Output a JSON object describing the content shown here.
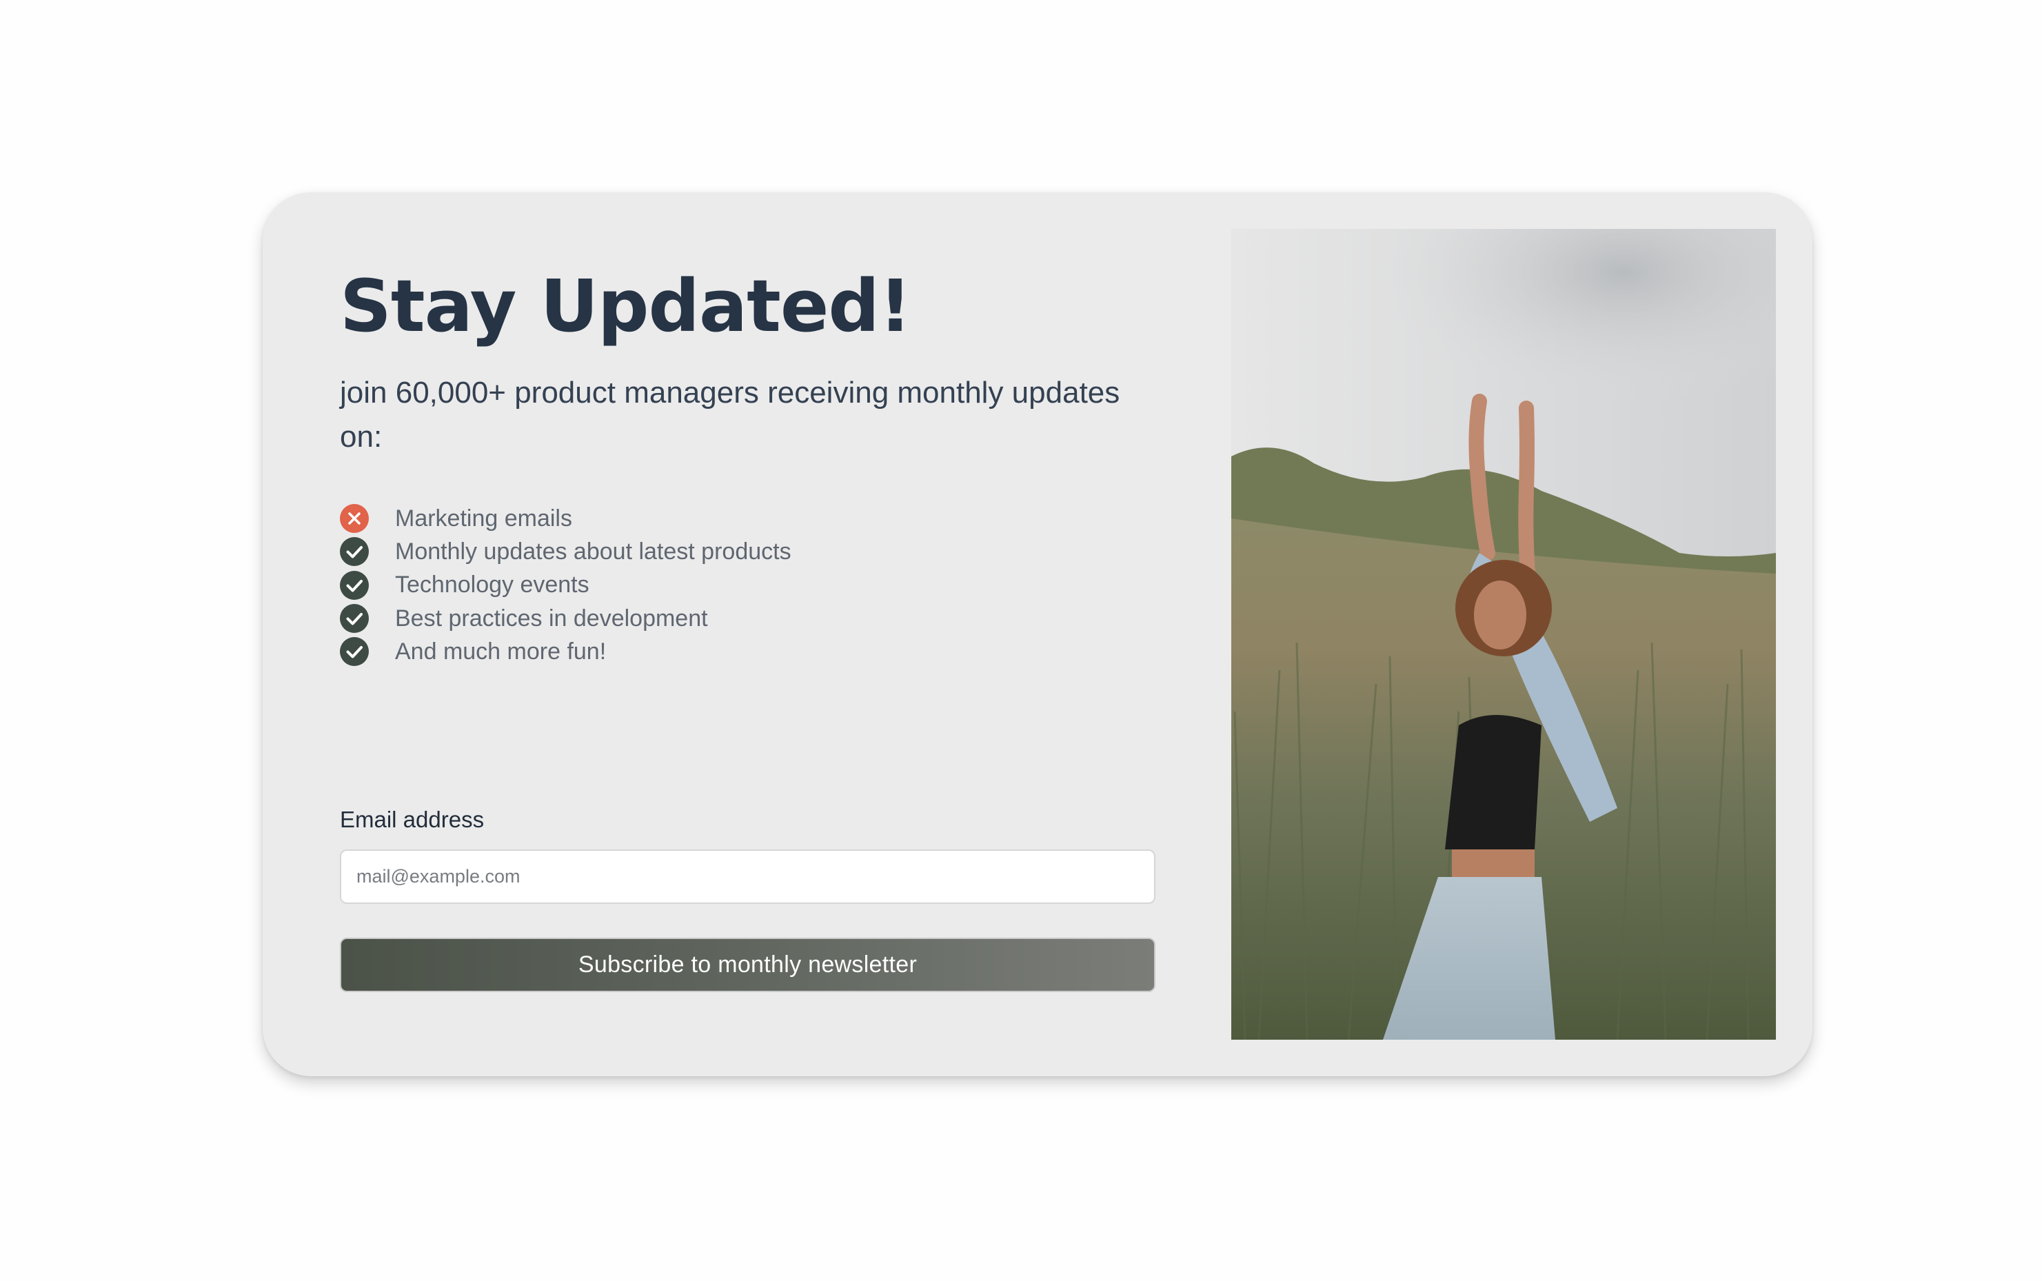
{
  "newsletter": {
    "title": "Stay Updated!",
    "subtitle": "join 60,000+ product managers receiving monthly updates on:",
    "features": [
      {
        "label": "Marketing emails",
        "icon": "x-circle-icon",
        "included": false
      },
      {
        "label": "Monthly updates about latest products",
        "icon": "check-circle-icon",
        "included": true
      },
      {
        "label": "Technology events",
        "icon": "check-circle-icon",
        "included": true
      },
      {
        "label": "Best practices in development",
        "icon": "check-circle-icon",
        "included": true
      },
      {
        "label": "And much more fun!",
        "icon": "check-circle-icon",
        "included": true
      }
    ],
    "email": {
      "label": "Email address",
      "placeholder": "mail@example.com",
      "value": ""
    },
    "subscribe_label": "Subscribe to monthly newsletter"
  },
  "colors": {
    "title": "#263445",
    "check": "#3e4b45",
    "cross": "#e0634a",
    "card": "#ebebeb",
    "button_start": "#4b5248",
    "button_end": "#7b7d79"
  }
}
